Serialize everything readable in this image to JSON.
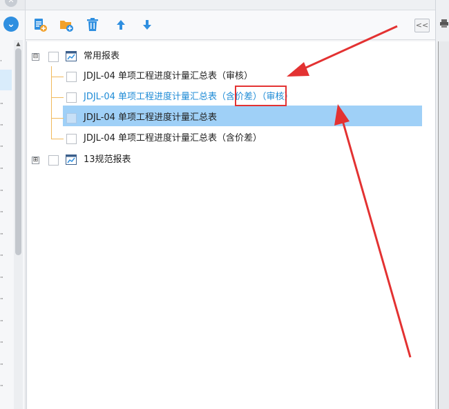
{
  "toolbar": {
    "buttons": [
      "add-report",
      "add-folder",
      "delete",
      "move-up",
      "move-down"
    ],
    "collapse_label": "<<"
  },
  "tree": {
    "group1": {
      "label": "常用报表",
      "expander": "⊟",
      "items": [
        {
          "label": "JDJL-04 单项工程进度计量汇总表（审核）",
          "color": "#222222"
        },
        {
          "label": "JDJL-04 单项工程进度计量汇总表（含价差）（审核）",
          "color": "#1e8bd6"
        },
        {
          "label": "JDJL-04 单项工程进度计量汇总表",
          "color": "#222222",
          "selected": true
        },
        {
          "label": "JDJL-04 单项工程进度计量汇总表（含价差）",
          "color": "#222222"
        }
      ]
    },
    "group2": {
      "label": "13规范报表",
      "expander": "⊞"
    }
  },
  "colors": {
    "accent": "#2f8fe0",
    "selection": "#9fd0f7",
    "annotation": "#e33232",
    "tree_line": "#f0b95a"
  }
}
